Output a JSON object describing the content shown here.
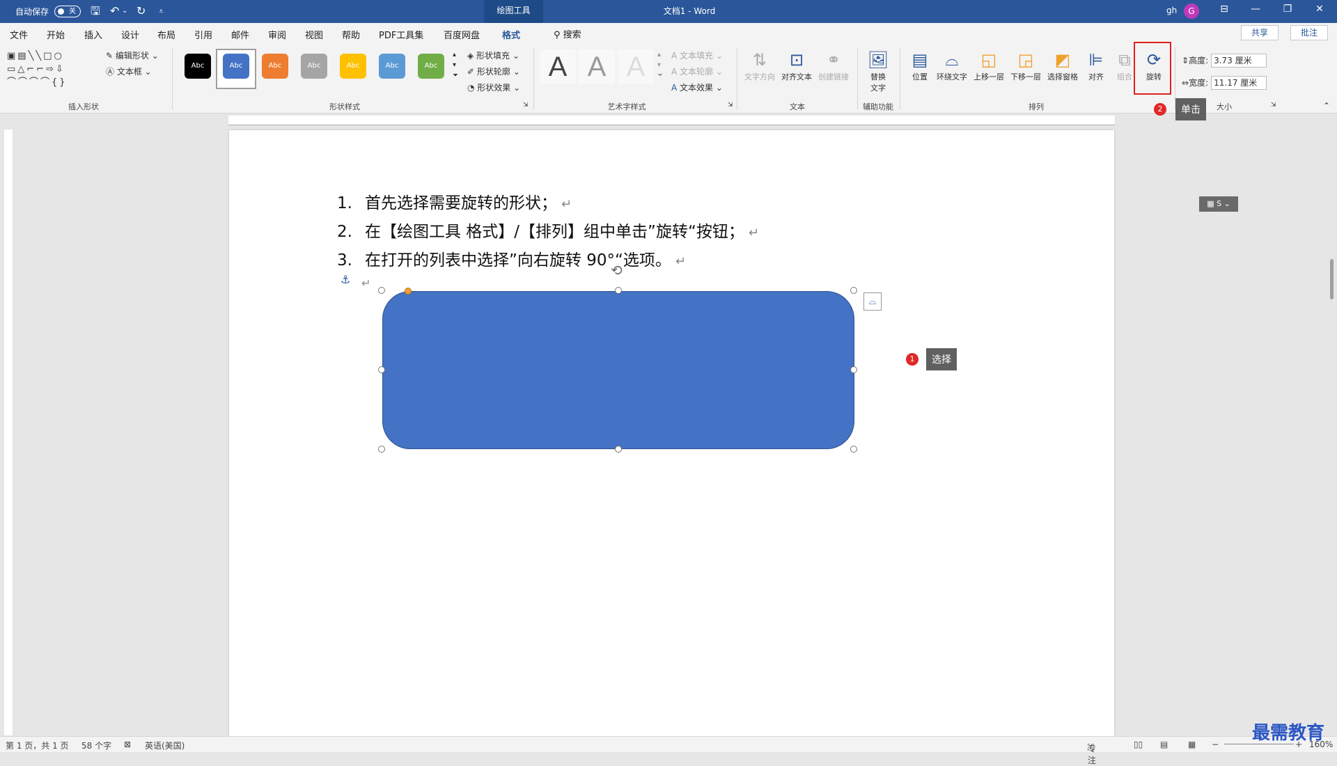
{
  "titlebar": {
    "autosave": "自动保存",
    "toggle": "关",
    "context_tab": "绘图工具",
    "doc_title": "文档1 - Word",
    "user": "gh",
    "avatar": "G"
  },
  "tabs": [
    "文件",
    "开始",
    "插入",
    "设计",
    "布局",
    "引用",
    "邮件",
    "审阅",
    "视图",
    "帮助",
    "PDF工具集",
    "百度网盘",
    "格式"
  ],
  "search_label": "搜索",
  "share": "共享",
  "comment": "批注",
  "ribbon": {
    "insert_shapes": {
      "label": "插入形状",
      "edit_shape": "编辑形状",
      "textbox": "文本框"
    },
    "shape_styles": {
      "label": "形状样式",
      "sample": "Abc",
      "fill": "形状填充",
      "outline": "形状轮廓",
      "effects": "形状效果",
      "colors": [
        "#000000",
        "#4472c4",
        "#ed7d31",
        "#a5a5a5",
        "#ffc000",
        "#5b9bd5",
        "#70ad47"
      ]
    },
    "wordart": {
      "label": "艺术字样式",
      "letter": "A",
      "fill": "文本填充",
      "outline": "文本轮廓",
      "effects": "文本效果"
    },
    "text": {
      "label": "文本",
      "direction": "文字方向",
      "align": "对齐文本",
      "link": "创建链接"
    },
    "accessibility": {
      "label": "辅助功能",
      "alt_text_1": "替换",
      "alt_text_2": "文字"
    },
    "arrange": {
      "label": "排列",
      "position": "位置",
      "wrap": "环绕文字",
      "forward": "上移一层",
      "backward": "下移一层",
      "pane": "选择窗格",
      "align": "对齐",
      "group": "组合",
      "rotate": "旋转"
    },
    "size": {
      "label": "大小",
      "height_label": "高度:",
      "height": "3.73 厘米",
      "width_label": "宽度:",
      "width": "11.17 厘米"
    }
  },
  "document": {
    "lines": [
      {
        "num": "1.",
        "text": "首先选择需要旋转的形状；"
      },
      {
        "num": "2.",
        "text": "在【绘图工具 格式】/【排列】组中单击”旋转“按钮；"
      },
      {
        "num": "3.",
        "text": "在打开的列表中选择”向右旋转 90°“选项。"
      }
    ],
    "pilcrow": "↵"
  },
  "callouts": {
    "select": {
      "badge": "1",
      "text": "选择"
    },
    "click": {
      "badge": "2",
      "text": "单击"
    }
  },
  "status": {
    "page": "第 1 页，共 1 页",
    "words": "58 个字",
    "lang": "英语(美国)",
    "focus": "专注",
    "zoom": "160%"
  },
  "watermark": "最需教育"
}
